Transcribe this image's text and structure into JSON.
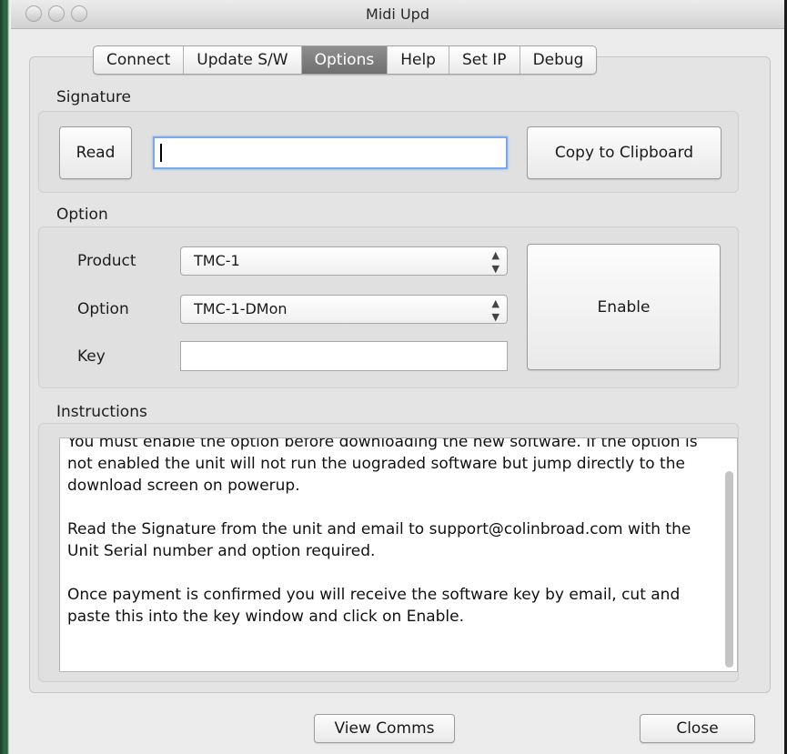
{
  "window": {
    "title": "Midi  Upd"
  },
  "tabs": [
    {
      "label": "Connect",
      "active": false
    },
    {
      "label": "Update S/W",
      "active": false
    },
    {
      "label": "Options",
      "active": true
    },
    {
      "label": "Help",
      "active": false
    },
    {
      "label": "Set IP",
      "active": false
    },
    {
      "label": "Debug",
      "active": false
    }
  ],
  "signature": {
    "section_label": "Signature",
    "read_label": "Read",
    "value": "",
    "copy_label": "Copy to Clipboard"
  },
  "option": {
    "section_label": "Option",
    "product_label": "Product",
    "product_value": "TMC-1",
    "option_label": "Option",
    "option_value": "TMC-1-DMon",
    "key_label": "Key",
    "key_value": "",
    "enable_label": "Enable"
  },
  "instructions": {
    "section_label": "Instructions",
    "paragraphs": [
      "You must enable the option before downloading the new software. If the option is not enabled the unit will not run the uograded software but jump directly to the download screen on powerup.",
      "Read the Signature from the unit and email to support@colinbroad.com with the Unit Serial number and option required.",
      "Once payment is confirmed you will receive the software key by email, cut and paste this into the key window and click on Enable."
    ]
  },
  "footer": {
    "view_comms_label": "View Comms",
    "close_label": "Close"
  },
  "icons": {
    "select_arrows": "updown-arrows-icon",
    "window_buttons": "traffic-light-icon"
  }
}
